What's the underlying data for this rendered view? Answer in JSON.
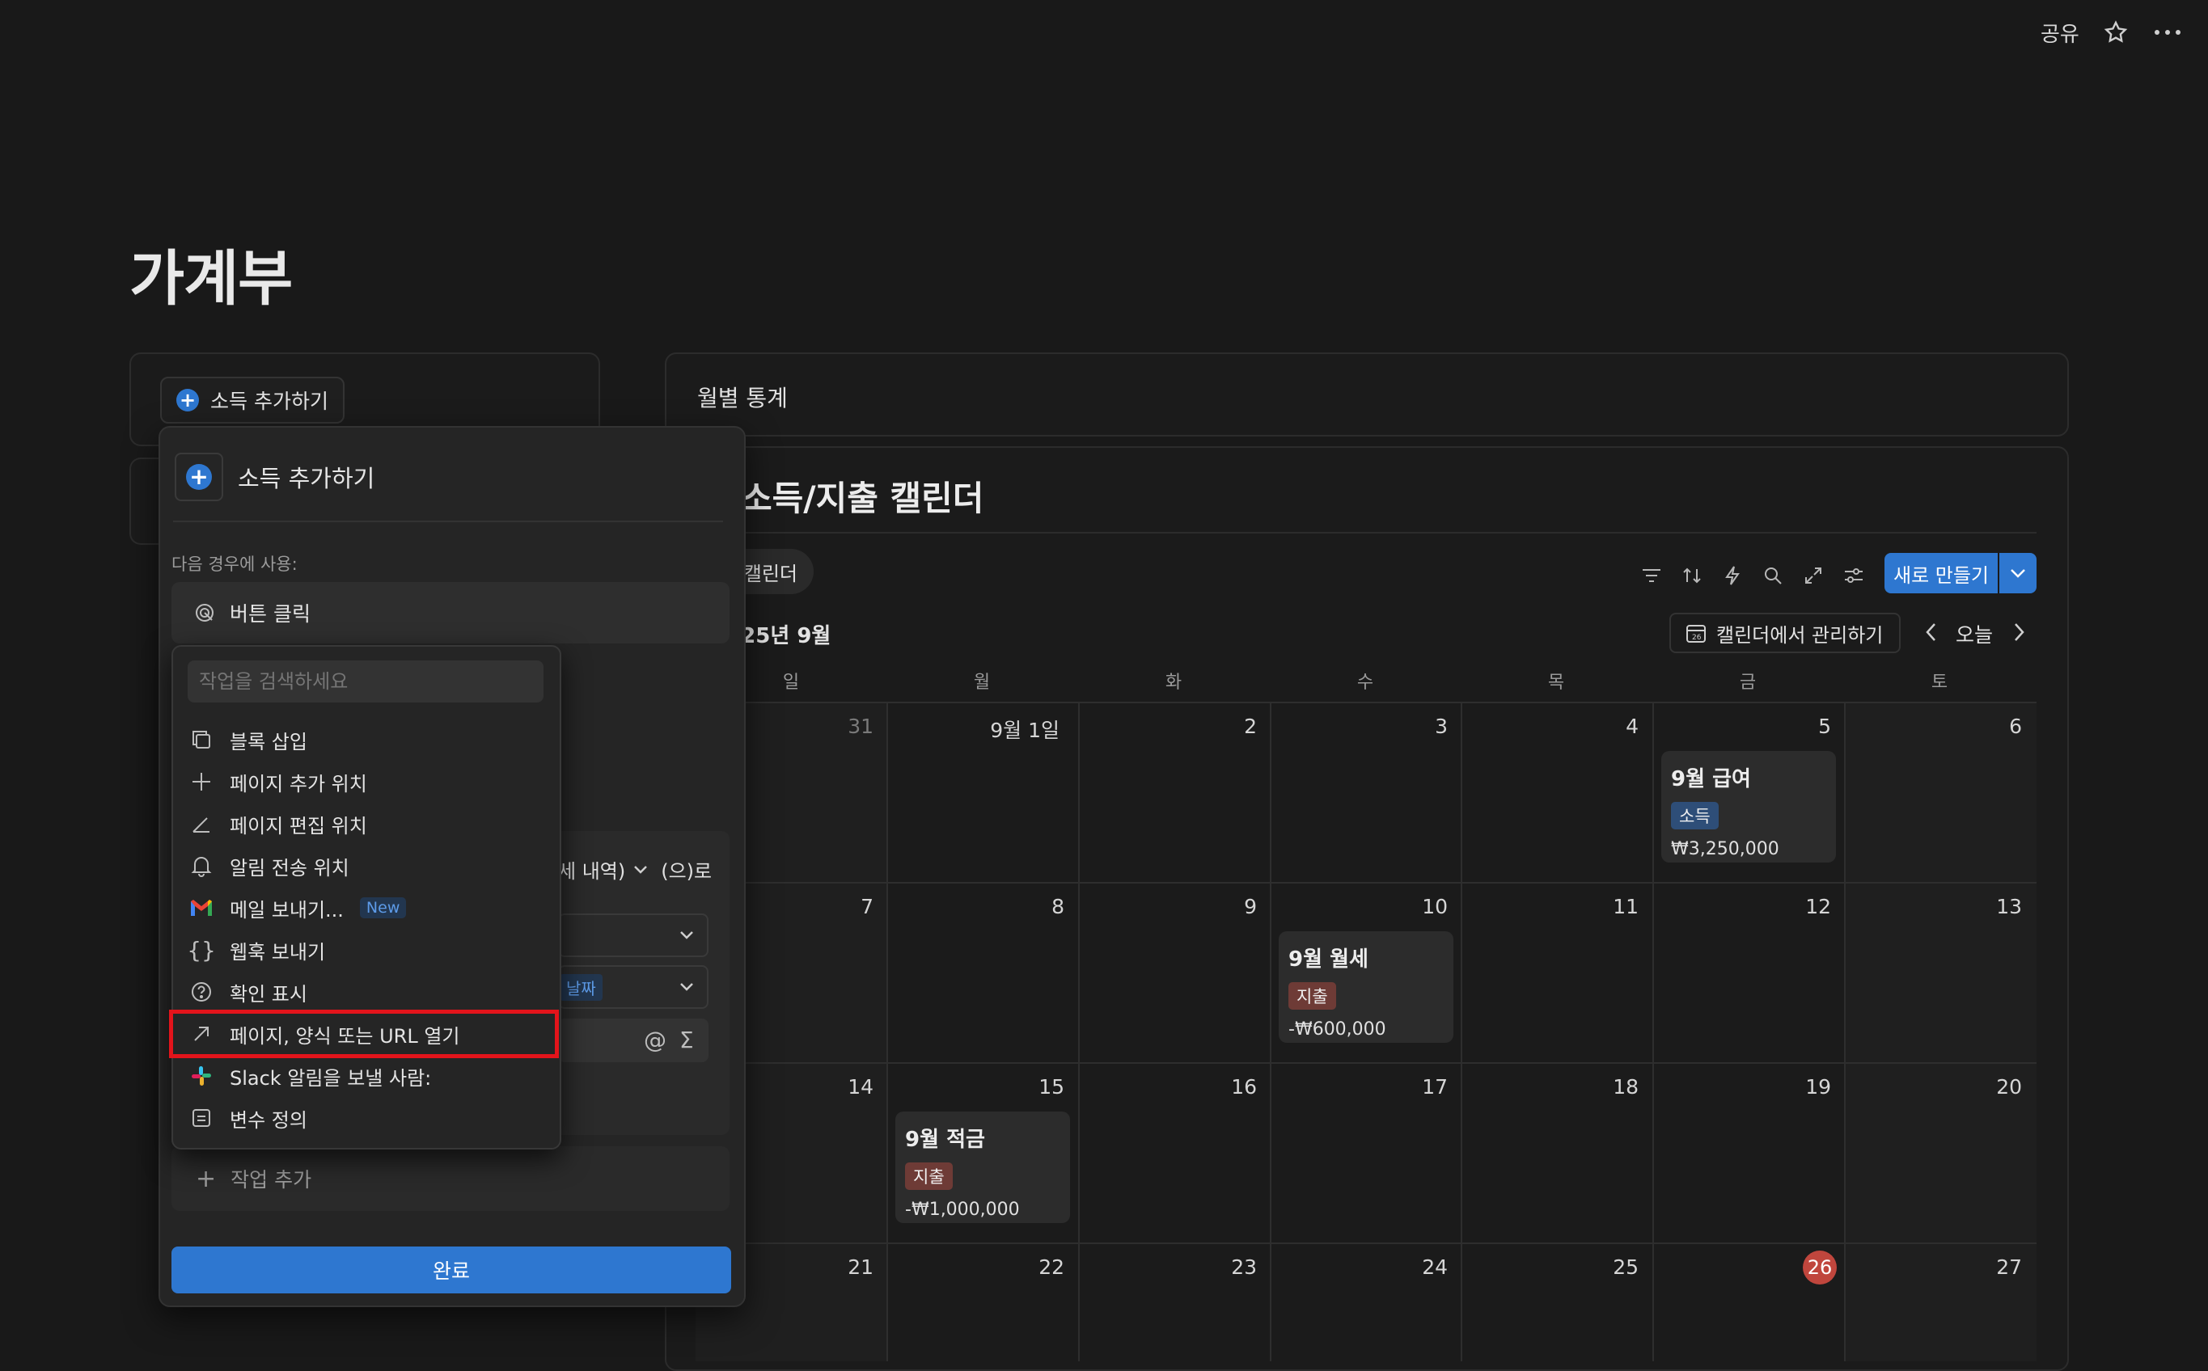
{
  "topbar": {
    "share_label": "공유"
  },
  "page": {
    "title": "가계부"
  },
  "left_panel": {
    "add_income_button": "소득 추가하기"
  },
  "stats_panel": {
    "title": "월별 통계"
  },
  "calendar": {
    "title": "소득/지출 캘린더",
    "view_tab": "캘린더",
    "new_button": "새로 만들기",
    "month_label": "2025년 9월",
    "manage_button": "캘린더에서 관리하기",
    "today_button": "오늘",
    "weekdays": [
      "일",
      "월",
      "화",
      "수",
      "목",
      "금",
      "토"
    ],
    "weeks": [
      [
        "31",
        "9월 1일",
        "2",
        "3",
        "4",
        "5",
        "6"
      ],
      [
        "7",
        "8",
        "9",
        "10",
        "11",
        "12",
        "13"
      ],
      [
        "14",
        "15",
        "16",
        "17",
        "18",
        "19",
        "20"
      ],
      [
        "21",
        "22",
        "23",
        "24",
        "25",
        "26",
        "27"
      ]
    ],
    "today_day": "26",
    "events": [
      {
        "title": "9월 급여",
        "tag": "소득",
        "amount": "₩3,250,000",
        "tag_color": "#2e4e78"
      },
      {
        "title": "9월 월세",
        "tag": "지출",
        "amount": "-₩600,000",
        "tag_color": "#6e3b36"
      },
      {
        "title": "9월 적금",
        "tag": "지출",
        "amount": "-₩1,000,000",
        "tag_color": "#6e3b36"
      }
    ]
  },
  "popover": {
    "title": "소득 추가하기",
    "use_when_label": "다음 경우에 사용:",
    "trigger": "버튼 클릭",
    "partial_row_select": "세 내역)",
    "partial_row_suffix": "(으)로",
    "partial_tag": "날짜",
    "add_action": "작업 추가",
    "done_button": "완료"
  },
  "action_menu": {
    "search_placeholder": "작업을 검색하세요",
    "items": [
      {
        "label": "블록 삽입",
        "icon": "copy-icon"
      },
      {
        "label": "페이지 추가 위치",
        "icon": "plus-icon"
      },
      {
        "label": "페이지 편집 위치",
        "icon": "edit-angle-icon"
      },
      {
        "label": "알림 전송 위치",
        "icon": "bell-icon"
      },
      {
        "label": "메일 보내기...",
        "icon": "gmail-icon",
        "badge": "New"
      },
      {
        "label": "웹훅 보내기",
        "icon": "braces-icon"
      },
      {
        "label": "확인 표시",
        "icon": "question-icon"
      },
      {
        "label": "페이지, 양식 또는 URL 열기",
        "icon": "arrow-up-right-icon"
      },
      {
        "label": "Slack 알림을 보낼 사람:",
        "icon": "slack-icon"
      },
      {
        "label": "변수 정의",
        "icon": "variable-icon"
      }
    ]
  },
  "colors": {
    "accent": "#2e77d0",
    "highlight": "#e3141b",
    "today": "#c0463d"
  }
}
